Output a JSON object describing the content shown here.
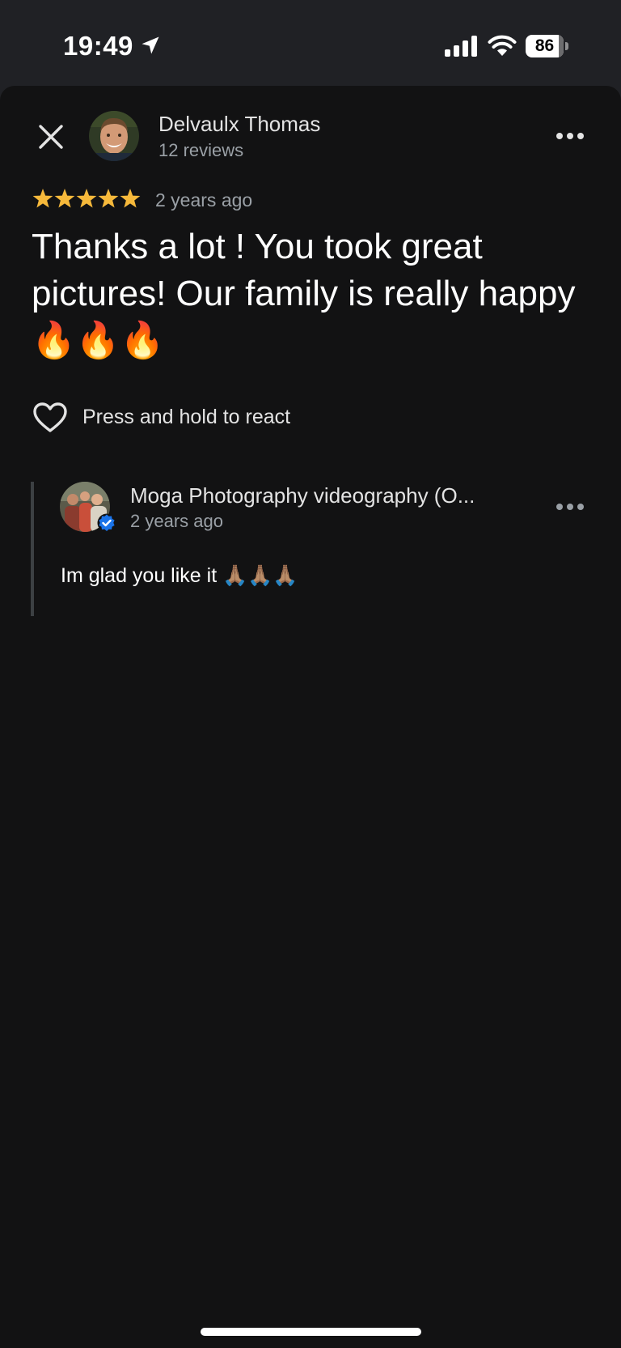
{
  "status_bar": {
    "time": "19:49",
    "battery": "86"
  },
  "review": {
    "author_name": "Delvaulx Thomas",
    "author_reviews": "12 reviews",
    "rating": 5,
    "star_color": "#f6b93b",
    "age": "2 years ago",
    "text": "Thanks a lot ! You took great pictures! Our family is really happy 🔥🔥🔥",
    "react_label": "Press and hold to react"
  },
  "reply": {
    "owner_name": "Moga Photography videography (O...",
    "age": "2 years ago",
    "text": "Im glad you like it 🙏🏽🙏🏽🙏🏽",
    "badge_color": "#1a73e8"
  },
  "colors": {
    "sheet_background": "#121213",
    "status_background": "#202125",
    "primary_text": "#ffffff",
    "secondary_text": "#9aa0a6"
  }
}
